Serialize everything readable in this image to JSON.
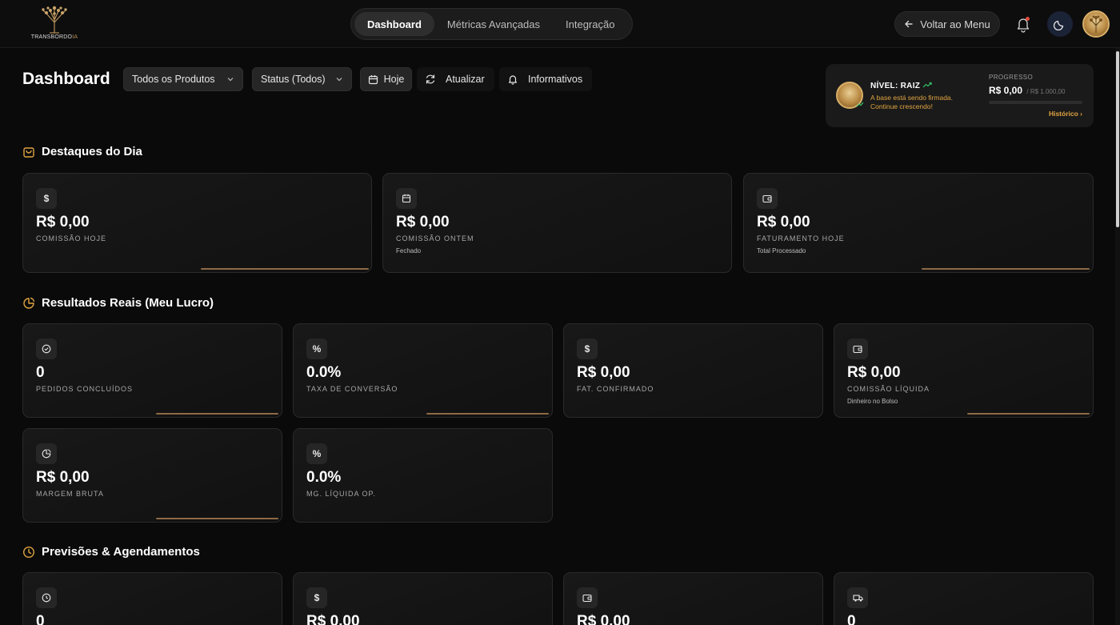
{
  "app": {
    "logo_text": "TRANSBORDO",
    "logo_suffix": "IA"
  },
  "nav": {
    "tabs": [
      "Dashboard",
      "Métricas Avançadas",
      "Integração"
    ],
    "active_tab": "Dashboard"
  },
  "header": {
    "back_label": "Voltar ao Menu"
  },
  "toolbar": {
    "title": "Dashboard",
    "products_select": "Todos os Produtos",
    "status_select": "Status (Todos)",
    "today_label": "Hoje",
    "update_label": "Atualizar",
    "info_label": "Informativos"
  },
  "level": {
    "title": "NÍVEL: RAIZ",
    "desc": "A base está sendo firmada. Continue crescendo!",
    "progress_label": "PROGRESSO",
    "progress_value": "R$ 0,00",
    "progress_goal": "/ R$ 1.000,00",
    "progress_fraction": 0,
    "history_link": "Histórico"
  },
  "sections": {
    "highlights": {
      "title": "Destaques do Dia",
      "cards": [
        {
          "icon": "dollar-icon",
          "value": "R$ 0,00",
          "label": "COMISSÃO HOJE",
          "sub": ""
        },
        {
          "icon": "calendar-icon",
          "value": "R$ 0,00",
          "label": "COMISSÃO ONTEM",
          "sub": "Fechado"
        },
        {
          "icon": "wallet-icon",
          "value": "R$ 0,00",
          "label": "FATURAMENTO HOJE",
          "sub": "Total Processado"
        }
      ]
    },
    "results": {
      "title": "Resultados Reais (Meu Lucro)",
      "cards": [
        {
          "icon": "check-circle-icon",
          "value": "0",
          "label": "PEDIDOS CONCLUÍDOS",
          "sub": ""
        },
        {
          "icon": "percent-icon",
          "value": "0.0%",
          "label": "TAXA DE CONVERSÃO",
          "sub": ""
        },
        {
          "icon": "dollar-icon",
          "value": "R$ 0,00",
          "label": "FAT. CONFIRMADO",
          "sub": ""
        },
        {
          "icon": "wallet-icon",
          "value": "R$ 0,00",
          "label": "COMISSÃO LÍQUIDA",
          "sub": "Dinheiro no Bolso"
        },
        {
          "icon": "pie-icon",
          "value": "R$ 0,00",
          "label": "MARGEM BRUTA",
          "sub": ""
        },
        {
          "icon": "percent-icon",
          "value": "0.0%",
          "label": "MG. LÍQUIDA OP.",
          "sub": ""
        }
      ]
    },
    "forecasts": {
      "title": "Previsões & Agendamentos",
      "cards": [
        {
          "icon": "clock-icon",
          "value": "0"
        },
        {
          "icon": "dollar-icon",
          "value": "R$ 0,00"
        },
        {
          "icon": "wallet-icon",
          "value": "R$ 0,00"
        },
        {
          "icon": "truck-icon",
          "value": "0"
        }
      ]
    }
  },
  "colors": {
    "accent": "#e0a441",
    "accent_line": "#8e6a45",
    "trend": "#35c46a",
    "background": "#0a0a0a"
  }
}
